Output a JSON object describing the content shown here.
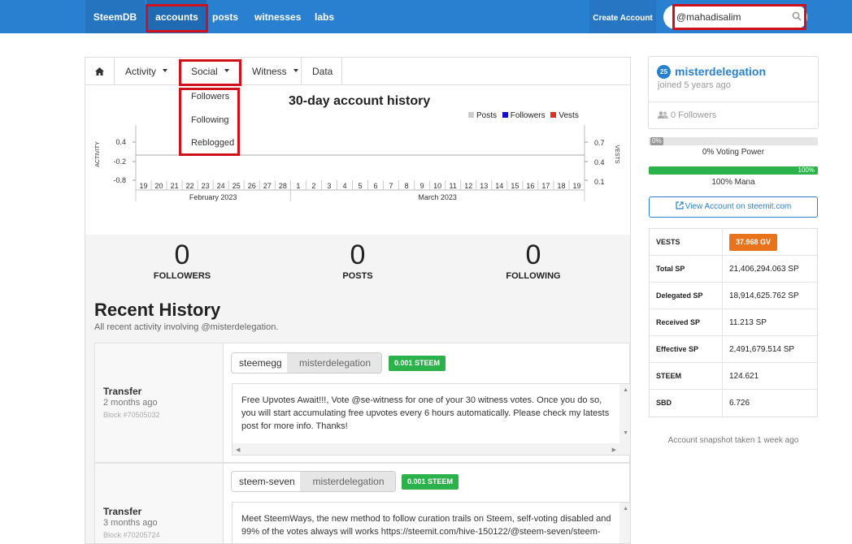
{
  "nav": {
    "brand": "SteemDB",
    "items": [
      "accounts",
      "posts",
      "witnesses",
      "labs"
    ],
    "create_account": "Create Account",
    "search_value": "@mahadisalim"
  },
  "tabs": {
    "activity": "Activity",
    "social": "Social",
    "witness": "Witness",
    "data": "Data"
  },
  "social_dropdown": [
    "Followers",
    "Following",
    "Reblogged"
  ],
  "chart_data": {
    "type": "line",
    "title": "30-day account history",
    "series": [
      {
        "name": "Posts",
        "color": "#cccccc",
        "values": [
          0,
          0,
          0,
          0,
          0,
          0,
          0,
          0,
          0,
          0,
          0,
          0,
          0,
          0,
          0,
          0,
          0,
          0,
          0,
          0,
          0,
          0,
          0,
          0,
          0,
          0,
          0,
          0,
          0,
          0,
          0
        ]
      },
      {
        "name": "Followers",
        "color": "#1010c8",
        "values": [
          0,
          0,
          0,
          0,
          0,
          0,
          0,
          0,
          0,
          0,
          0,
          0,
          0,
          0,
          0,
          0,
          0,
          0,
          0,
          0,
          0,
          0,
          0,
          0,
          0,
          0,
          0,
          0,
          0,
          0,
          0
        ]
      },
      {
        "name": "Vests",
        "color": "#e03020",
        "values": [
          0,
          0,
          0,
          0,
          0,
          0,
          0,
          0,
          0,
          0,
          0,
          0,
          0,
          0,
          0,
          0,
          0,
          0,
          0,
          0,
          0,
          0,
          0,
          0,
          0,
          0,
          0,
          0,
          0,
          0,
          0
        ]
      }
    ],
    "categories": [
      "19",
      "20",
      "21",
      "22",
      "23",
      "24",
      "25",
      "26",
      "27",
      "28",
      "1",
      "2",
      "3",
      "4",
      "5",
      "6",
      "7",
      "8",
      "9",
      "10",
      "11",
      "12",
      "13",
      "14",
      "15",
      "16",
      "17",
      "18",
      "19"
    ],
    "month_labels": [
      "February 2023",
      "March 2023"
    ],
    "ylabel_left": "ACTIVITY",
    "ylabel_right": "VESTS",
    "left_ticks": [
      "0.4",
      "-0.2",
      "-0.8"
    ],
    "right_ticks": [
      "0.7",
      "0.4",
      "0.1"
    ]
  },
  "stats": [
    {
      "value": "0",
      "label": "FOLLOWERS"
    },
    {
      "value": "0",
      "label": "POSTS"
    },
    {
      "value": "0",
      "label": "FOLLOWING"
    }
  ],
  "recent": {
    "title": "Recent History",
    "subtitle": "All recent activity involving @misterdelegation.",
    "items": [
      {
        "type": "Transfer",
        "ago": "2 months ago",
        "block": "Block #70505032",
        "from": "steemegg",
        "to": "misterdelegation",
        "amount": "0.001 STEEM",
        "memo": "Free Upvotes Await!!!, Vote @se-witness for one of your 30 witness votes. Once you do so, you will start accumulating free upvotes every 6 hours automatically. Please check my latests post for more info. Thanks!"
      },
      {
        "type": "Transfer",
        "ago": "3 months ago",
        "block": "Block #70205724",
        "from": "steem-seven",
        "to": "misterdelegation",
        "amount": "0.001 STEEM",
        "memo": "Meet SteemWays, the new method to follow curation trails on Steem, self-voting disabled and 99% of the votes always will works https://steemit.com/hive-150122/@steem-seven/steem-"
      }
    ]
  },
  "profile": {
    "reputation": "25",
    "username": "misterdelegation",
    "joined": "joined 5 years ago",
    "followers": "0 Followers",
    "voting_label": "0%",
    "voting_caption": "0% Voting Power",
    "voting_fraction": 0,
    "mana_label": "100%",
    "mana_caption": "100% Mana",
    "mana_fraction": 1,
    "view_button": "View Account on steemit.com",
    "snapshot": "Account snapshot taken 1 week ago"
  },
  "values": [
    {
      "key": "VESTS",
      "value": "37.968 GV",
      "badge": true
    },
    {
      "key": "Total SP",
      "value": "21,406,294.063 SP"
    },
    {
      "key": "Delegated SP",
      "value": "18,914,625.762 SP"
    },
    {
      "key": "Received SP",
      "value": "11.213 SP"
    },
    {
      "key": "Effective SP",
      "value": "2,491,679.514 SP"
    },
    {
      "key": "STEEM",
      "value": "124.621"
    },
    {
      "key": "SBD",
      "value": "6.726"
    }
  ]
}
